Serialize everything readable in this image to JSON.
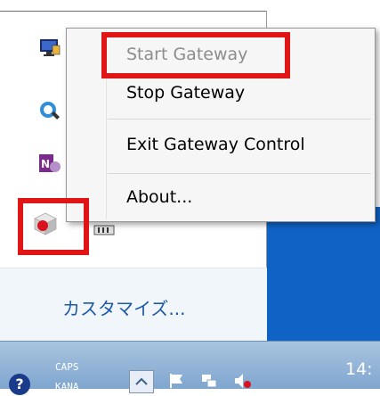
{
  "context_menu": {
    "items": [
      {
        "label": "Start Gateway",
        "enabled": false
      },
      {
        "label": "Stop Gateway",
        "enabled": true
      },
      {
        "label": "Exit Gateway Control",
        "enabled": true
      },
      {
        "label": "About...",
        "enabled": true
      }
    ]
  },
  "overflow_panel": {
    "customize_label": "カスタマイズ...",
    "icons": [
      "monitor-icon",
      "search-refresh-icon",
      "onenote-icon",
      "gateway-cube-icon"
    ]
  },
  "taskbar": {
    "caps_label": "CAPS",
    "kana_label": "KANA",
    "clock_text": "14:"
  },
  "colors": {
    "highlight": "#e01515",
    "desktop": "#0e63c5",
    "link": "#1c5aa8",
    "disabled_text": "#8d8d8d"
  }
}
